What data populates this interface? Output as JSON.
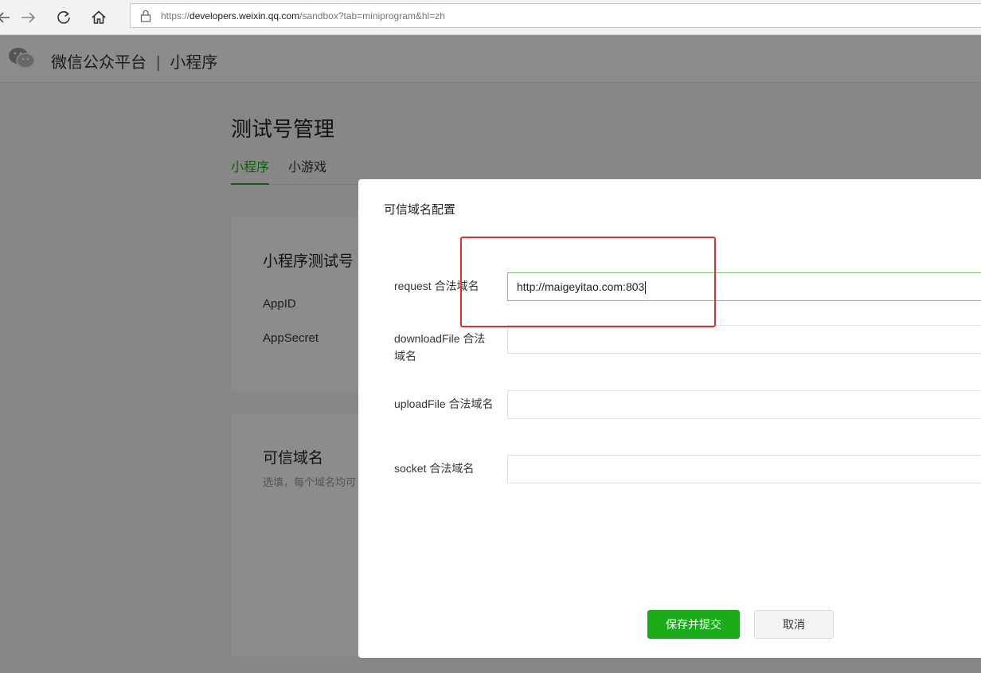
{
  "browser": {
    "url_prefix": "https://",
    "url_host": "developers.weixin.qq.com",
    "url_path": "/sandbox?tab=miniprogram&hl=zh",
    "icons": [
      "back-icon",
      "forward-icon",
      "refresh-icon",
      "home-icon",
      "lock-icon"
    ]
  },
  "header": {
    "brand": "微信公众平台",
    "separator": "|",
    "section": "小程序"
  },
  "page": {
    "title": "测试号管理",
    "tabs": [
      {
        "label": "小程序",
        "active": true
      },
      {
        "label": "小游戏",
        "active": false
      }
    ],
    "card1": {
      "title": "小程序测试号",
      "appid_label": "AppID",
      "appsecret_label": "AppSecret"
    },
    "card2": {
      "title": "可信域名",
      "hint": "选填，每个域名均可"
    }
  },
  "dialog": {
    "title": "可信域名配置",
    "rows": [
      {
        "label": "request 合法域名",
        "value": "http://maigeyitao.com:803"
      },
      {
        "label": "downloadFile 合法域名",
        "value": ""
      },
      {
        "label": "uploadFile 合法域名",
        "value": ""
      },
      {
        "label": "socket 合法域名",
        "value": ""
      }
    ],
    "save_label": "保存并提交",
    "cancel_label": "取消"
  },
  "colors": {
    "accent": "#1aad19",
    "highlight": "#e03131"
  }
}
